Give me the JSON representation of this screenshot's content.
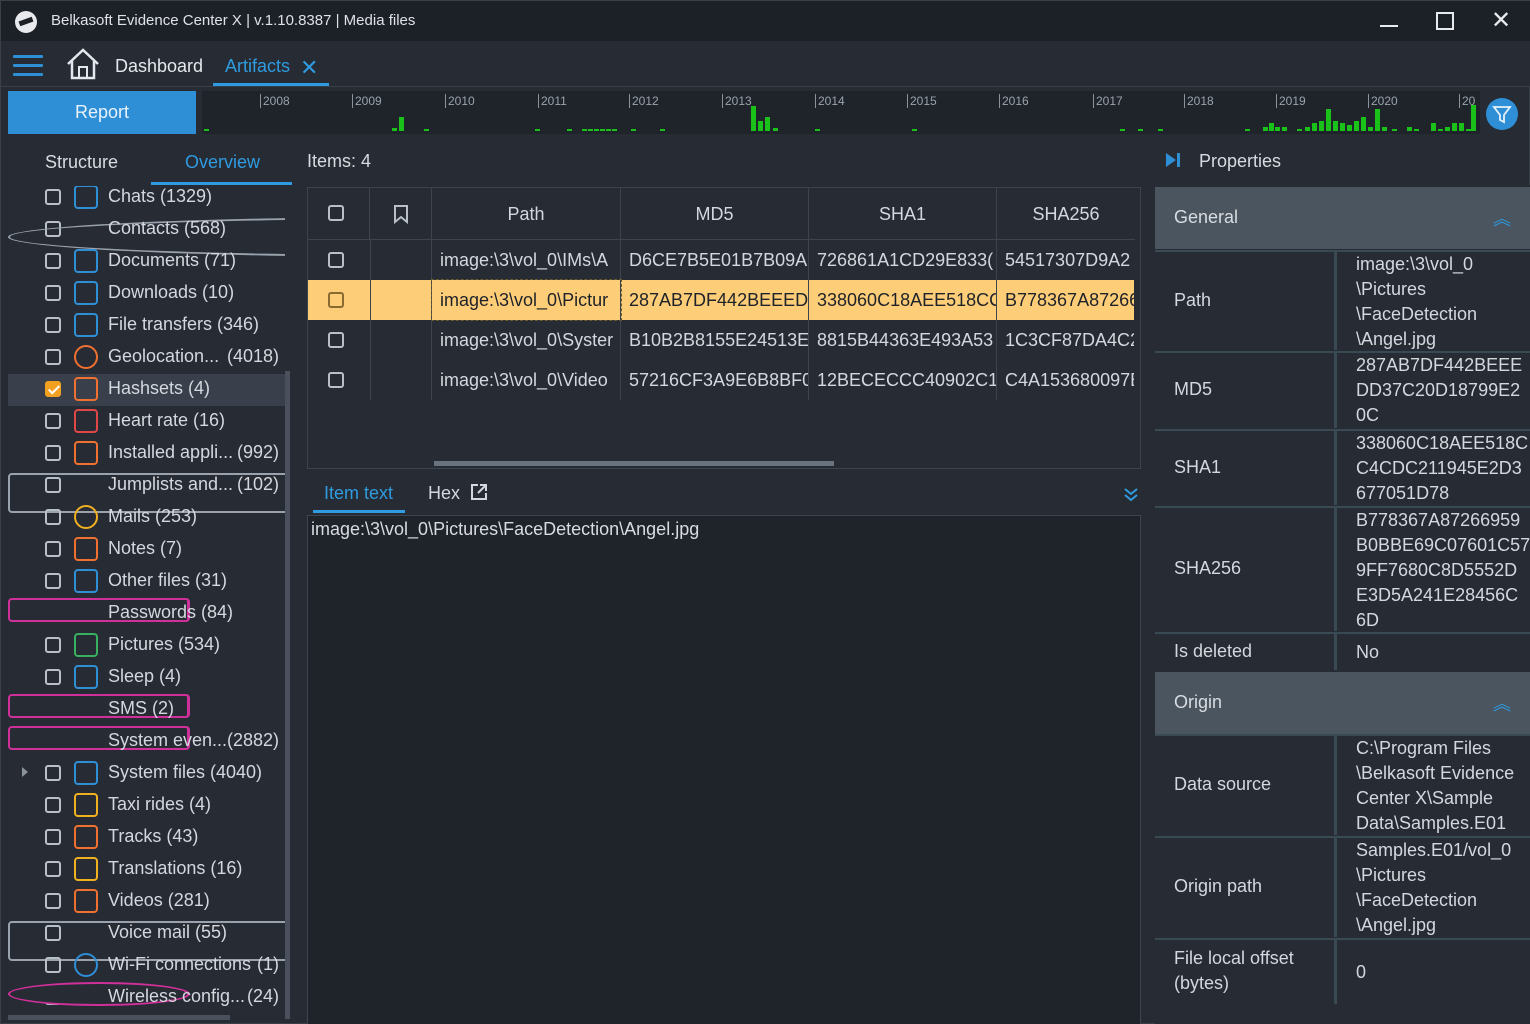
{
  "window": {
    "title": "Belkasoft Evidence Center X | v.1.10.8387 | Media files"
  },
  "nav": {
    "dashboard": "Dashboard",
    "artifacts": "Artifacts"
  },
  "toolbar": {
    "report": "Report"
  },
  "timeline": {
    "years": [
      "2008",
      "2009",
      "2010",
      "2011",
      "2012",
      "2013",
      "2014",
      "2015",
      "2016",
      "2017",
      "2018",
      "2019",
      "2020",
      "20"
    ],
    "bar_color": "#19c119"
  },
  "left": {
    "tabs": [
      "Structure",
      "Overview"
    ],
    "items": [
      {
        "label": "Chats (1329)",
        "count": "",
        "icon": "chat-icon",
        "checked": false
      },
      {
        "label": "Contacts (568)",
        "count": "",
        "icon": "contact-icon",
        "checked": false
      },
      {
        "label": "Documents (71)",
        "count": "",
        "icon": "document-icon",
        "checked": false
      },
      {
        "label": "Downloads (10)",
        "count": "",
        "icon": "download-icon",
        "checked": false
      },
      {
        "label": "File transfers (346)",
        "count": "",
        "icon": "file-transfer-icon",
        "checked": false
      },
      {
        "label": "Geolocation...",
        "count": "(4018)",
        "icon": "geolocation-icon",
        "checked": false
      },
      {
        "label": "Hashsets (4)",
        "count": "",
        "icon": "hash-icon",
        "checked": true
      },
      {
        "label": "Heart rate (16)",
        "count": "",
        "icon": "heart-icon",
        "checked": false
      },
      {
        "label": "Installed appli...",
        "count": "(992)",
        "icon": "app-icon",
        "checked": false
      },
      {
        "label": "Jumplists and...",
        "count": "(102)",
        "icon": "link-icon",
        "checked": false
      },
      {
        "label": "Mails (253)",
        "count": "",
        "icon": "mail-icon",
        "checked": false
      },
      {
        "label": "Notes (7)",
        "count": "",
        "icon": "note-icon",
        "checked": false
      },
      {
        "label": "Other files (31)",
        "count": "",
        "icon": "file-icon",
        "checked": false
      },
      {
        "label": "Passwords (84)",
        "count": "",
        "icon": "key-icon",
        "checked": false
      },
      {
        "label": "Pictures (534)",
        "count": "",
        "icon": "picture-icon",
        "checked": false
      },
      {
        "label": "Sleep (4)",
        "count": "",
        "icon": "sleep-icon",
        "checked": false
      },
      {
        "label": "SMS (2)",
        "count": "",
        "icon": "sms-icon",
        "checked": false
      },
      {
        "label": "System even...",
        "count": "(2882)",
        "icon": "log-icon",
        "checked": false
      },
      {
        "label": "System files (4040)",
        "count": "",
        "icon": "system-files-icon",
        "checked": false
      },
      {
        "label": "Taxi rides (4)",
        "count": "",
        "icon": "taxi-icon",
        "checked": false
      },
      {
        "label": "Tracks (43)",
        "count": "",
        "icon": "track-icon",
        "checked": false
      },
      {
        "label": "Translations (16)",
        "count": "",
        "icon": "translation-icon",
        "checked": false
      },
      {
        "label": "Videos (281)",
        "count": "",
        "icon": "video-icon",
        "checked": false
      },
      {
        "label": "Voice mail (55)",
        "count": "",
        "icon": "microphone-icon",
        "checked": false
      },
      {
        "label": "Wi-Fi connections",
        "count": "(1)",
        "icon": "wifi-icon",
        "checked": false
      },
      {
        "label": "Wireless config...",
        "count": "(24)",
        "icon": "wireless-icon",
        "checked": false
      }
    ]
  },
  "center": {
    "items_count": "Items: 4",
    "columns": [
      "Path",
      "MD5",
      "SHA1",
      "SHA256"
    ],
    "rows": [
      {
        "path": "image:\\3\\vol_0\\IMs\\A",
        "md5": "D6CE7B5E01B7B09A5",
        "sha1": "726861A1CD29E833(",
        "sha256": "54517307D9A2"
      },
      {
        "path": "image:\\3\\vol_0\\Pictur",
        "md5": "287AB7DF442BEEEDI",
        "sha1": "338060C18AEE518CC",
        "sha256": "B778367A87266"
      },
      {
        "path": "image:\\3\\vol_0\\Syster",
        "md5": "B10B2B8155E24513E",
        "sha1": "8815B44363E493A53",
        "sha256": "1C3CF87DA4C2"
      },
      {
        "path": "image:\\3\\vol_0\\Video",
        "md5": "57216CF3A9E6B8BF0",
        "sha1": "12BECECCC40902C14",
        "sha256": "C4A153680097E"
      }
    ],
    "highlight_color": "#fdcd78",
    "tabs": {
      "item_text": "Item text",
      "hex": "Hex"
    },
    "item_text": "image:\\3\\vol_0\\Pictures\\FaceDetection\\Angel.jpg"
  },
  "properties": {
    "title": "Properties",
    "general": {
      "title": "General",
      "rows": [
        {
          "key": "Path",
          "value": [
            "image:\\3\\vol_0",
            "\\Pictures",
            "\\FaceDetection",
            "\\Angel.jpg"
          ]
        },
        {
          "key": "MD5",
          "value": [
            "287AB7DF442BEEE",
            "DD37C20D18799E2",
            "0C"
          ]
        },
        {
          "key": "SHA1",
          "value": [
            "338060C18AEE518C",
            "C4CDC211945E2D3",
            "677051D78"
          ]
        },
        {
          "key": "SHA256",
          "value": [
            "B778367A87266959",
            "B0BBE69C07601C57",
            "9FF7680C8D5552D",
            "E3D5A241E28456C",
            "6D"
          ]
        },
        {
          "key": "Is deleted",
          "value": [
            "No"
          ]
        }
      ]
    },
    "origin": {
      "title": "Origin",
      "rows": [
        {
          "key": "Data source",
          "value": [
            "C:\\Program Files",
            "\\Belkasoft Evidence",
            "Center X\\Sample",
            "Data\\Samples.E01"
          ]
        },
        {
          "key": "Origin path",
          "value": [
            "Samples.E01/vol_0",
            "\\Pictures",
            "\\FaceDetection",
            "\\Angel.jpg"
          ]
        },
        {
          "key_lines": [
            "File local offset",
            "(bytes)"
          ],
          "value": [
            "0"
          ]
        }
      ]
    }
  }
}
